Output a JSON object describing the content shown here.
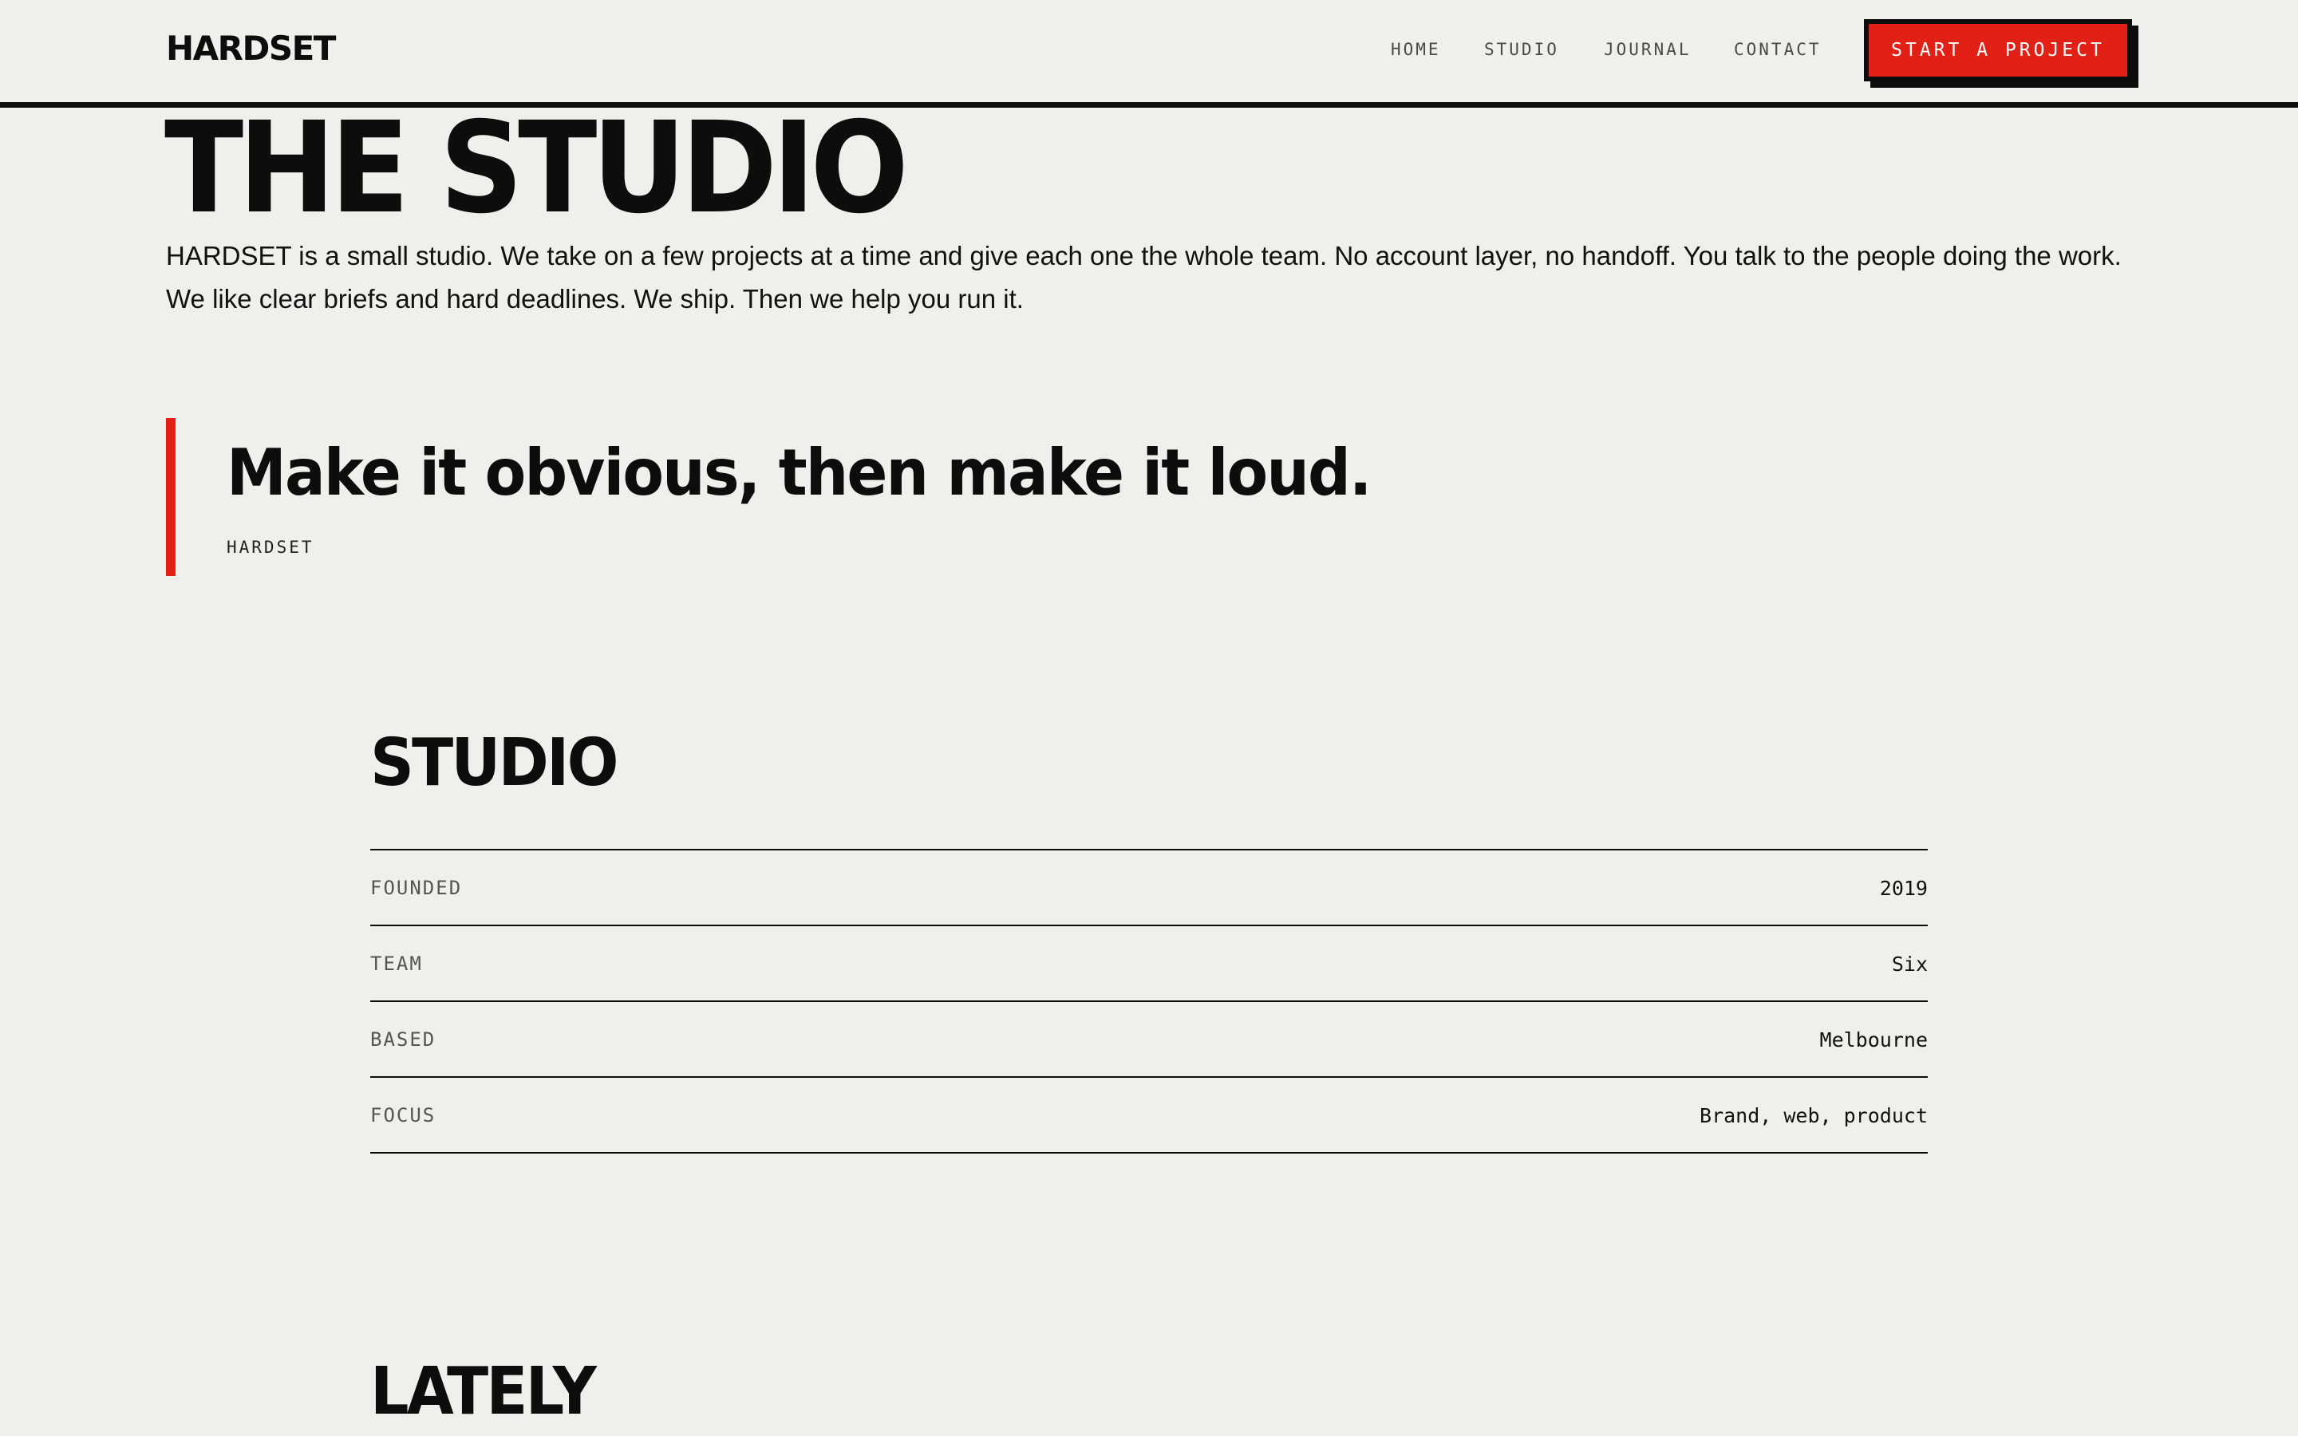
{
  "brand": {
    "name": "HARDSET",
    "accent": "#e22015",
    "ink": "#0d0d0d",
    "background": "#f0efeb"
  },
  "nav": {
    "items": [
      {
        "label": "HOME"
      },
      {
        "label": "STUDIO"
      },
      {
        "label": "JOURNAL"
      },
      {
        "label": "CONTACT"
      }
    ],
    "cta_label": "START A PROJECT"
  },
  "hero": {
    "title": "THE STUDIO",
    "paragraphs": [
      "HARDSET is a small studio. We take on a few projects at a time and give each one the whole team. No account layer, no handoff. You talk to the people doing the work.",
      "We like clear briefs and hard deadlines. We ship. Then we help you run it."
    ]
  },
  "quote": {
    "text": "Make it obvious, then make it loud.",
    "author": "HARDSET"
  },
  "studio": {
    "title": "STUDIO",
    "facts": [
      {
        "label": "FOUNDED",
        "value": "2019"
      },
      {
        "label": "TEAM",
        "value": "Six"
      },
      {
        "label": "BASED",
        "value": "Melbourne"
      },
      {
        "label": "FOCUS",
        "value": "Brand, web, product"
      }
    ]
  },
  "lately": {
    "title": "LATELY"
  }
}
